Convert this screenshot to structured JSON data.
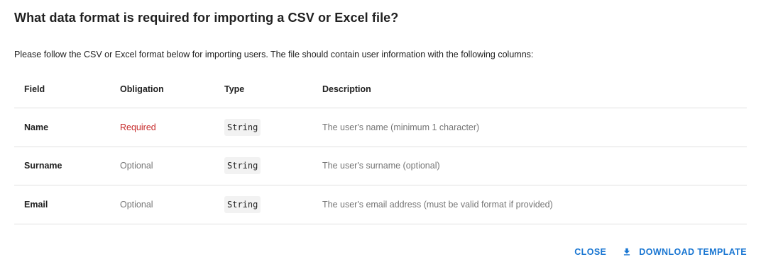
{
  "dialog": {
    "title": "What data format is required for importing a CSV or Excel file?",
    "intro": "Please follow the CSV or Excel format below for importing users. The file should contain user information with the following columns:"
  },
  "table": {
    "headers": {
      "field": "Field",
      "obligation": "Obligation",
      "type": "Type",
      "description": "Description"
    },
    "rows": [
      {
        "field": "Name",
        "obligation": "Required",
        "type": "String",
        "description": "The user's name (minimum 1 character)"
      },
      {
        "field": "Surname",
        "obligation": "Optional",
        "type": "String",
        "description": "The user's surname (optional)"
      },
      {
        "field": "Email",
        "obligation": "Optional",
        "type": "String",
        "description": "The user's email address (must be valid format if provided)"
      }
    ]
  },
  "actions": {
    "close_label": "CLOSE",
    "download_label": "DOWNLOAD TEMPLATE",
    "download_icon": "download-icon"
  },
  "colors": {
    "accent": "#1976d2",
    "required": "#c62828",
    "muted": "#757575"
  }
}
